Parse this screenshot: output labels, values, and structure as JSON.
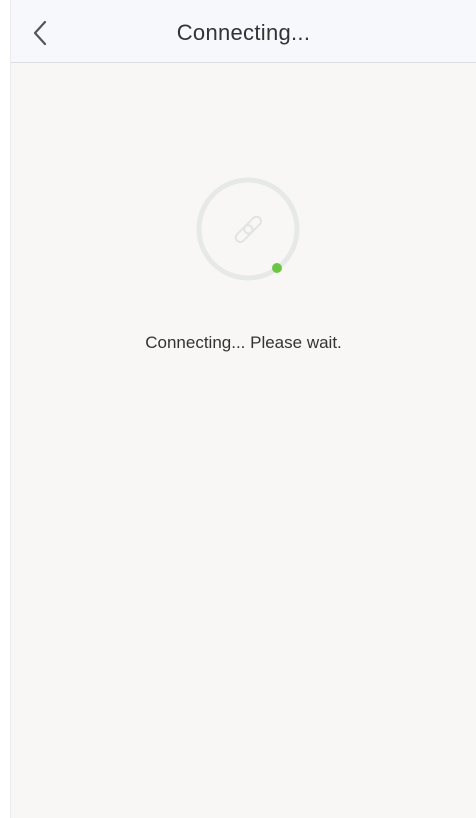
{
  "navbar": {
    "title": "Connecting...",
    "back_icon": "chevron-left-icon"
  },
  "main": {
    "spinner_icon": "link-icon",
    "status_text": "Connecting... Please wait."
  },
  "colors": {
    "accent": "#6cc644",
    "ring": "#e6e9e8",
    "background": "#f8f7f6",
    "navbar": "#f7f8fb",
    "text": "#333333"
  }
}
